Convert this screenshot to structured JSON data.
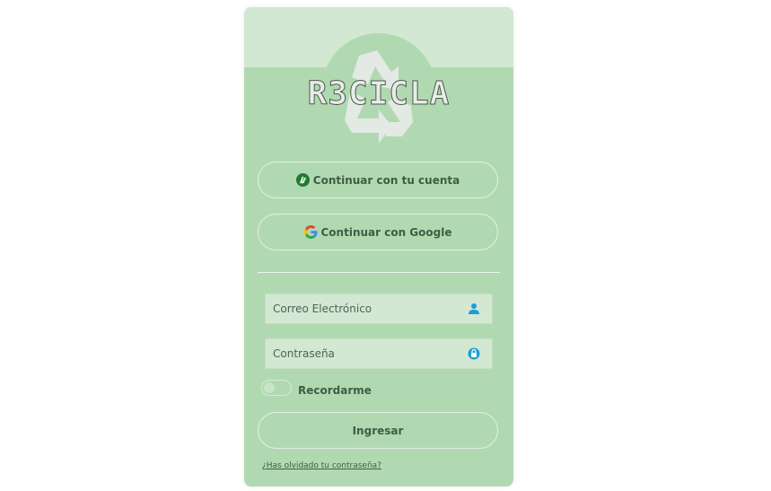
{
  "brand": {
    "logo_text": "R3CICLA",
    "logo_icon": "recycle-icon"
  },
  "auth": {
    "account_button_label": "Continuar con tu cuenta",
    "account_button_icon": "r3cicla-app-icon",
    "google_button_label": "Continuar con Google",
    "google_button_icon": "google-icon"
  },
  "form": {
    "email_placeholder": "Correo Electrónico",
    "email_icon": "user-icon",
    "password_placeholder": "Contraseña",
    "password_icon": "lock-icon",
    "remember_label": "Recordarme",
    "remember_checked": false,
    "submit_label": "Ingresar",
    "forgot_link": "¿Has olvidado tu contraseña?"
  },
  "colors": {
    "card_background": "#b1d9b1",
    "card_header": "#d2e8d3",
    "text": "#3f5c44",
    "input_icon": "#1a9fd6"
  }
}
